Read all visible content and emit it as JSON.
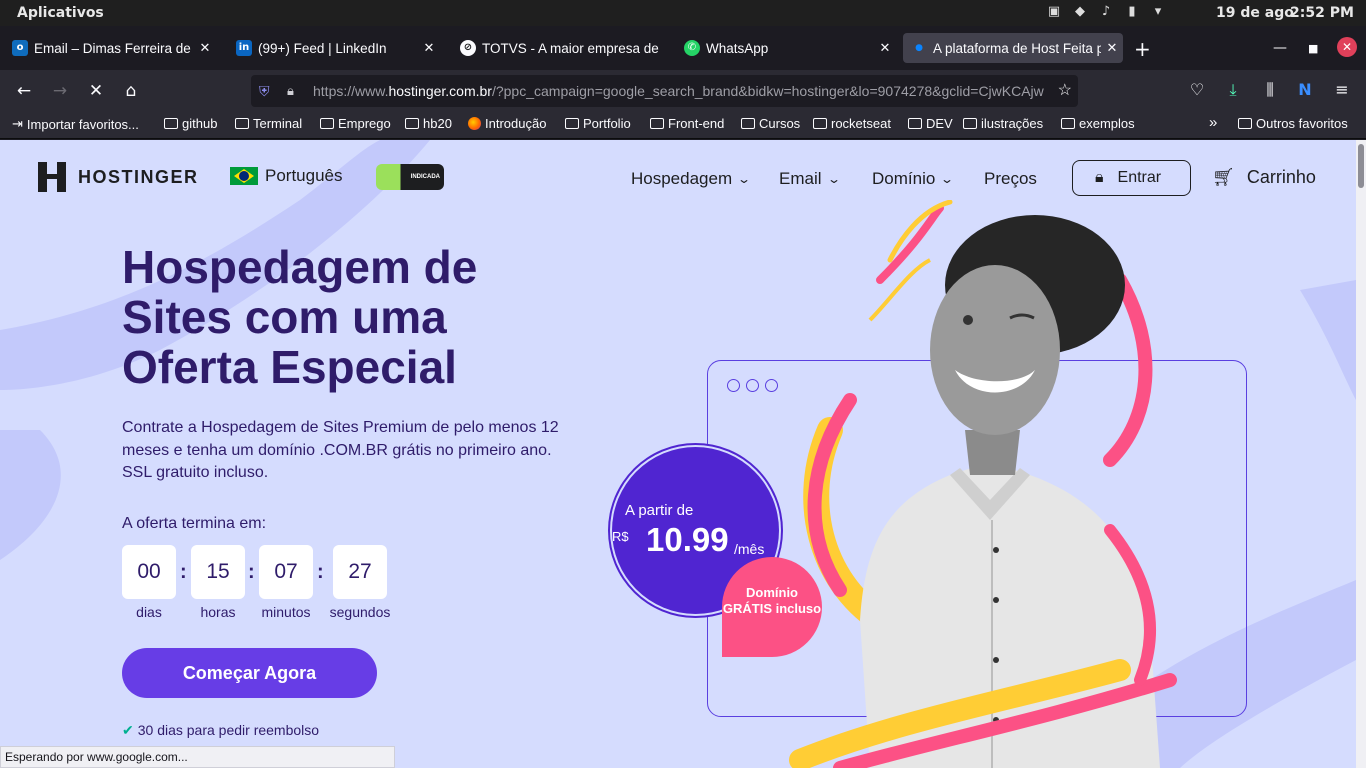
{
  "os": {
    "apps_label": "Aplicativos",
    "date": "19 de ago",
    "time": "2:52 PM"
  },
  "tabs": [
    {
      "label": "Email – Dimas Ferreira de Ca",
      "icon": "outlook-icon",
      "color": "#0f6cbd"
    },
    {
      "label": "(99+) Feed | LinkedIn",
      "icon": "linkedin-icon",
      "color": "#0a66c2"
    },
    {
      "label": "TOTVS - A maior empresa de",
      "icon": "totvs-icon",
      "color": "#1d1e20"
    },
    {
      "label": "WhatsApp",
      "icon": "whatsapp-icon",
      "color": "#25d366"
    },
    {
      "label": "A plataforma de Host Feita p",
      "icon": "loading-icon",
      "color": "#0a84ff"
    }
  ],
  "url": {
    "prefix": "https://www.",
    "domain": "hostinger.com.br",
    "rest": "/?ppc_campaign=google_search_brand&bidkw=hostinger&lo=9074278&gclid=CjwKCAjw"
  },
  "bookmarks": [
    "Importar favoritos...",
    "github",
    "Terminal",
    "Emprego",
    "hb20",
    "Introdução",
    "Portfolio",
    "Front-end",
    "Cursos",
    "rocketseat",
    "DEV",
    "ilustrações",
    "exemplos"
  ],
  "bookmarks_other": "Outros favoritos",
  "site": {
    "logo": "HOSTINGER",
    "language": "Português",
    "badge": "INDICADA",
    "menu": [
      "Hospedagem",
      "Email",
      "Domínio",
      "Preços"
    ],
    "login": "Entrar",
    "cart": "Carrinho",
    "hero_title": "Hospedagem de Sites com uma Oferta Especial",
    "hero_desc": "Contrate a Hospedagem de Sites Premium de pelo menos 12 meses e tenha um domínio .COM.BR grátis no primeiro ano. SSL gratuito incluso.",
    "offer_label": "A oferta termina em:",
    "countdown": [
      {
        "value": "00",
        "unit": "dias"
      },
      {
        "value": "15",
        "unit": "horas"
      },
      {
        "value": "07",
        "unit": "minutos"
      },
      {
        "value": "27",
        "unit": "segundos"
      }
    ],
    "cta": "Começar Agora",
    "refund": "30 dias para pedir reembolso",
    "price_from": "A partir de",
    "price_currency": "R$",
    "price_value": "10.99",
    "price_period": "/mês",
    "domain_badge": "Domínio GRÁTIS incluso"
  },
  "status_text": "Esperando por www.google.com...",
  "colors": {
    "brand_purple": "#673de6",
    "hero_bg": "#d5dcfe",
    "title": "#2f1c6a",
    "pink": "#fc5185"
  }
}
